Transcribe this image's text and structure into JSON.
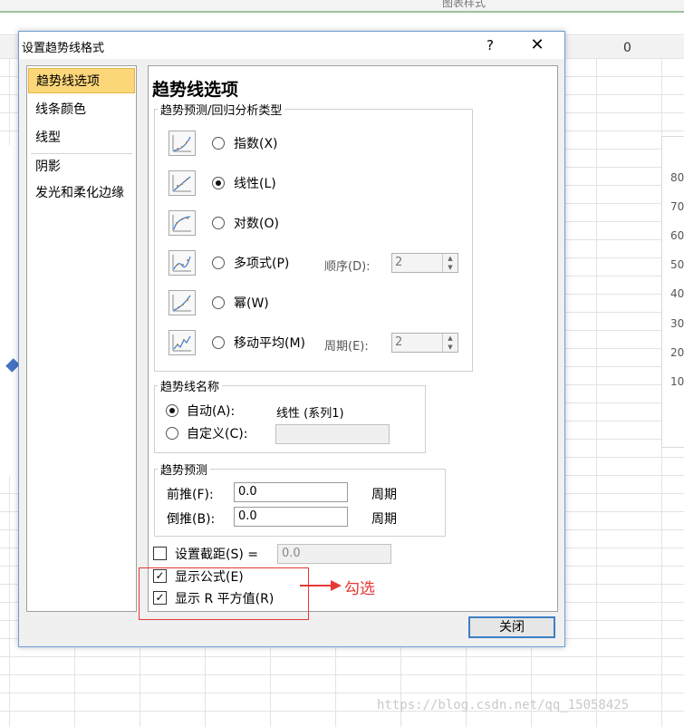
{
  "background": {
    "ribbon_text": "图表样式",
    "column_header": "0",
    "y_ticks": [
      "80",
      "70",
      "60",
      "50",
      "40",
      "30",
      "20",
      "10"
    ],
    "watermark": "https://blog.csdn.net/qq_15058425"
  },
  "dialog": {
    "title": "设置趋势线格式",
    "help_label": "?",
    "close_x": "✕",
    "close_button": "关闭"
  },
  "nav": {
    "items": [
      {
        "label": "趋势线选项",
        "selected": true
      },
      {
        "label": "线条颜色",
        "selected": false
      },
      {
        "label": "线型",
        "selected": false
      },
      {
        "label": "阴影",
        "selected": false
      },
      {
        "label": "发光和柔化边缘",
        "selected": false
      }
    ]
  },
  "main": {
    "heading": "趋势线选项",
    "type_group": {
      "title": "趋势预测/回归分析类型",
      "types": [
        {
          "label": "指数(X)",
          "icon": "exponential-chart-icon",
          "selected": false
        },
        {
          "label": "线性(L)",
          "icon": "linear-chart-icon",
          "selected": true
        },
        {
          "label": "对数(O)",
          "icon": "logarithmic-chart-icon",
          "selected": false
        },
        {
          "label": "多项式(P)",
          "icon": "polynomial-chart-icon",
          "selected": false
        },
        {
          "label": "幂(W)",
          "icon": "power-chart-icon",
          "selected": false
        },
        {
          "label": "移动平均(M)",
          "icon": "moving-average-chart-icon",
          "selected": false
        }
      ],
      "order_label": "顺序(D):",
      "order_value": "2",
      "period_label": "周期(E):",
      "period_value": "2"
    },
    "name_group": {
      "title": "趋势线名称",
      "auto_label": "自动(A):",
      "auto_value": "线性 (系列1)",
      "custom_label": "自定义(C):",
      "custom_value": "",
      "auto_selected": true
    },
    "forecast_group": {
      "title": "趋势预测",
      "forward_label": "前推(F):",
      "forward_value": "0.0",
      "forward_unit": "周期",
      "backward_label": "倒推(B):",
      "backward_value": "0.0",
      "backward_unit": "周期"
    },
    "intercept": {
      "label": "设置截距(S) =",
      "value": "0.0",
      "checked": false
    },
    "show_equation": {
      "label": "显示公式(E)",
      "checked": true
    },
    "show_r_squared": {
      "label": "显示 R 平方值(R)",
      "checked": true
    }
  },
  "annotation": {
    "text": "勾选",
    "color": "#e53935"
  },
  "colors": {
    "nav_selected_bg": "#fbd77a",
    "dialog_border": "#6a9fd4",
    "button_border": "#3c7fc4"
  }
}
